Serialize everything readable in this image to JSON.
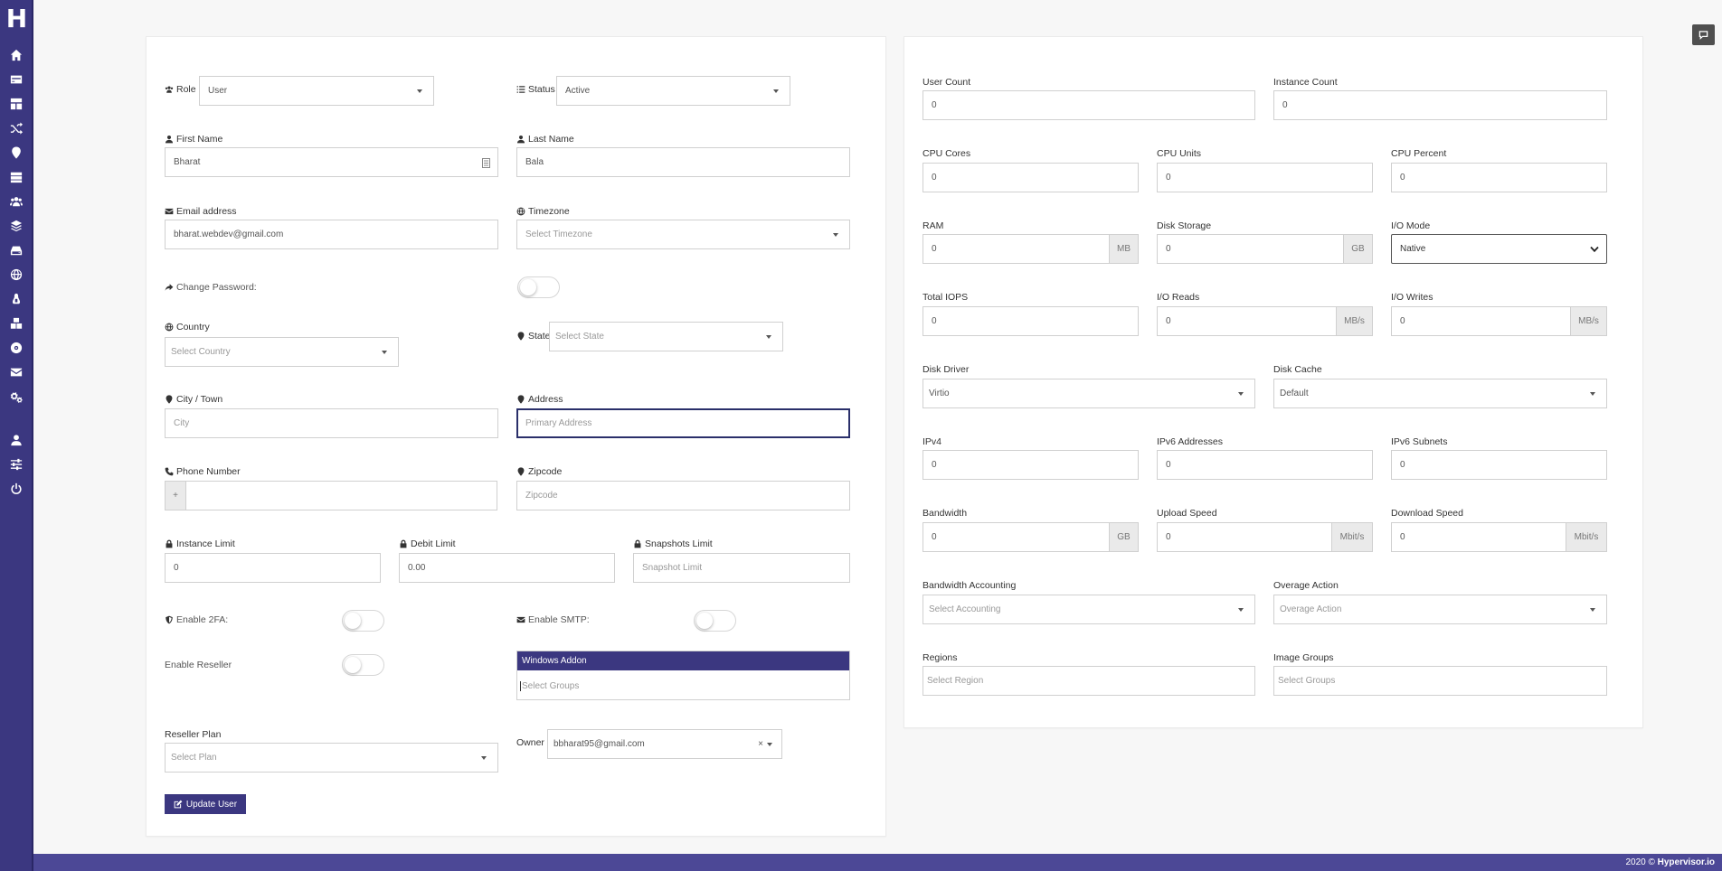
{
  "sidebar": {
    "logo": "H",
    "icons": [
      "home-icon",
      "card-icon",
      "dashboard-icon",
      "shuffle-icon",
      "map-marker-icon",
      "server-icon",
      "users-icon",
      "layers-icon",
      "hdd-icon",
      "globe-icon",
      "linux-icon",
      "boxes-icon",
      "disc-icon",
      "envelope-icon",
      "cogs-icon",
      "user-icon",
      "sliders-icon",
      "power-icon"
    ]
  },
  "form": {
    "role": {
      "label": "Role",
      "value": "User"
    },
    "status": {
      "label": "Status",
      "value": "Active"
    },
    "first_name": {
      "label": "First Name",
      "value": "Bharat"
    },
    "last_name": {
      "label": "Last Name",
      "value": "Bala"
    },
    "email": {
      "label": "Email address",
      "value": "bharat.webdev@gmail.com"
    },
    "timezone": {
      "label": "Timezone",
      "placeholder": "Select Timezone"
    },
    "change_password": {
      "label": "Change Password:"
    },
    "country": {
      "label": "Country",
      "placeholder": "Select Country"
    },
    "state": {
      "label": "State",
      "placeholder": "Select State"
    },
    "city": {
      "label": "City / Town",
      "placeholder": "City"
    },
    "address": {
      "label": "Address",
      "placeholder": "Primary Address"
    },
    "phone": {
      "label": "Phone Number",
      "prefix": "+"
    },
    "zipcode": {
      "label": "Zipcode",
      "placeholder": "Zipcode"
    },
    "instance_limit": {
      "label": "Instance Limit",
      "value": "0"
    },
    "debit_limit": {
      "label": "Debit Limit",
      "value": "0.00"
    },
    "snapshots_limit": {
      "label": "Snapshots Limit",
      "placeholder": "Snapshot Limit"
    },
    "enable_2fa": {
      "label": "Enable 2FA:"
    },
    "enable_smtp": {
      "label": "Enable SMTP:"
    },
    "enable_reseller": {
      "label": "Enable Reseller"
    },
    "groups": {
      "tag": "Windows Addon",
      "placeholder": "Select Groups"
    },
    "reseller_plan": {
      "label": "Reseller Plan",
      "placeholder": "Select Plan"
    },
    "owner": {
      "label": "Owner",
      "value": "bbharat95@gmail.com",
      "clear": "×"
    },
    "update_button": "Update User"
  },
  "limits": {
    "user_count": {
      "label": "User Count",
      "value": "0"
    },
    "instance_count": {
      "label": "Instance Count",
      "value": "0"
    },
    "cpu_cores": {
      "label": "CPU Cores",
      "value": "0"
    },
    "cpu_units": {
      "label": "CPU Units",
      "value": "0"
    },
    "cpu_percent": {
      "label": "CPU Percent",
      "value": "0"
    },
    "ram": {
      "label": "RAM",
      "value": "0",
      "unit": "MB"
    },
    "disk_storage": {
      "label": "Disk Storage",
      "value": "0",
      "unit": "GB"
    },
    "io_mode": {
      "label": "I/O Mode",
      "value": "Native"
    },
    "total_iops": {
      "label": "Total IOPS",
      "value": "0"
    },
    "io_reads": {
      "label": "I/O Reads",
      "value": "0",
      "unit": "MB/s"
    },
    "io_writes": {
      "label": "I/O Writes",
      "value": "0",
      "unit": "MB/s"
    },
    "disk_driver": {
      "label": "Disk Driver",
      "value": "Virtio"
    },
    "disk_cache": {
      "label": "Disk Cache",
      "value": "Default"
    },
    "ipv4": {
      "label": "IPv4",
      "value": "0"
    },
    "ipv6_addresses": {
      "label": "IPv6 Addresses",
      "value": "0"
    },
    "ipv6_subnets": {
      "label": "IPv6 Subnets",
      "value": "0"
    },
    "bandwidth": {
      "label": "Bandwidth",
      "value": "0",
      "unit": "GB"
    },
    "upload_speed": {
      "label": "Upload Speed",
      "value": "0",
      "unit": "Mbit/s"
    },
    "download_speed": {
      "label": "Download Speed",
      "value": "0",
      "unit": "Mbit/s"
    },
    "bandwidth_accounting": {
      "label": "Bandwidth Accounting",
      "placeholder": "Select Accounting"
    },
    "overage_action": {
      "label": "Overage Action",
      "placeholder": "Overage Action"
    },
    "regions": {
      "label": "Regions",
      "placeholder": "Select Region"
    },
    "image_groups": {
      "label": "Image Groups",
      "placeholder": "Select Groups"
    }
  },
  "footer": {
    "year": "2020 ©",
    "brand": "Hypervisor.io"
  }
}
